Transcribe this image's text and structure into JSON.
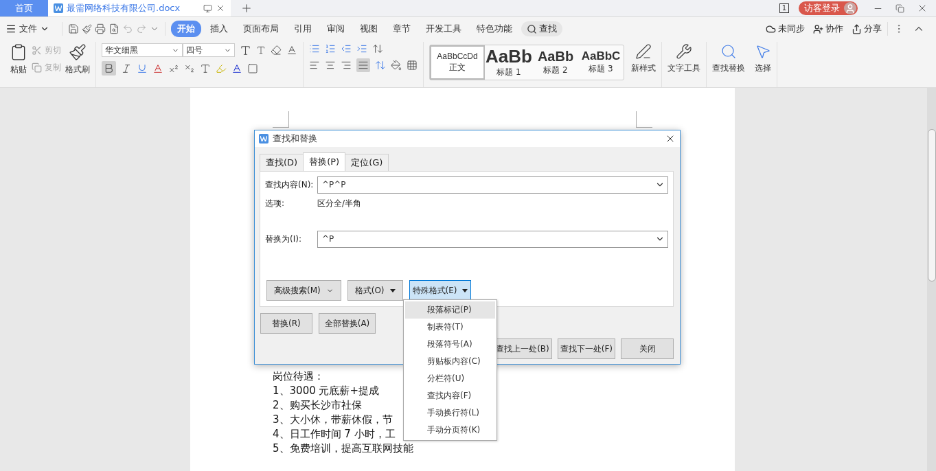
{
  "title_bar": {
    "home_tab": "首页",
    "documents": [
      {
        "title": "最需网络科技有限公司.docx",
        "selected": true
      }
    ],
    "page_indicator": "1",
    "login": "访客登录"
  },
  "menu_bar": {
    "file": "文件",
    "tabs": [
      {
        "label": "开始",
        "selected": true
      },
      {
        "label": "插入",
        "selected": false
      },
      {
        "label": "页面布局",
        "selected": false
      },
      {
        "label": "引用",
        "selected": false
      },
      {
        "label": "审阅",
        "selected": false
      },
      {
        "label": "视图",
        "selected": false
      },
      {
        "label": "章节",
        "selected": false
      },
      {
        "label": "开发工具",
        "selected": false
      },
      {
        "label": "特色功能",
        "selected": false
      }
    ],
    "search": "查找",
    "actions": [
      "未同步",
      "协作",
      "分享"
    ]
  },
  "ribbon": {
    "paste": "粘贴",
    "clipboard": [
      {
        "label": "剪切",
        "disabled": true
      },
      {
        "label": "复制",
        "disabled": true
      }
    ],
    "format_painter": "格式刷",
    "font": {
      "name": "华文细黑",
      "size": "四号"
    },
    "bold": {
      "pressed": true
    },
    "justify": {
      "pressed": true
    },
    "styles": [
      {
        "preview": "AaBbCcDd",
        "label": "正文",
        "kind": "body",
        "selected": true
      },
      {
        "preview": "AaBb",
        "label": "标题 1",
        "kind": "h1",
        "selected": false
      },
      {
        "preview": "AaBb",
        "label": "标题 2",
        "kind": "h2",
        "selected": false
      },
      {
        "preview": "AaBbC",
        "label": "标题 3",
        "kind": "h3",
        "selected": false
      }
    ],
    "tools": [
      "新样式",
      "文字工具",
      "查找替换",
      "选择"
    ]
  },
  "document": {
    "lines": [
      "岗位待遇：",
      "1、3000 元底薪+提成",
      "2、购买长沙市社保",
      "3、大小休，带薪休假，节",
      "4、日工作时间 7 小时，工",
      "5、免费培训，提高互联网技能"
    ]
  },
  "dialog": {
    "title": "查找和替换",
    "tabs": [
      {
        "label": "查找(D)",
        "selected": false
      },
      {
        "label": "替换(P)",
        "selected": true
      },
      {
        "label": "定位(G)",
        "selected": false
      }
    ],
    "find": {
      "label": "查找内容(N):",
      "value": "^P^P"
    },
    "options": {
      "label": "选项:",
      "value": "区分全/半角"
    },
    "replace": {
      "label": "替换为(I):",
      "value": "^P"
    },
    "option_buttons": [
      {
        "label": "高级搜索(M)",
        "active": false
      },
      {
        "label": "格式(O)",
        "active": false
      },
      {
        "label": "特殊格式(E)",
        "active": true
      }
    ],
    "replace_buttons": [
      "替换(R)",
      "全部替换(A)"
    ],
    "nav_buttons": [
      "查找上一处(B)",
      "查找下一处(F)",
      "关闭"
    ]
  },
  "special_menu": {
    "items": [
      {
        "label": "段落标记(P)",
        "selected": true
      },
      {
        "label": "制表符(T)",
        "selected": false
      },
      {
        "label": "段落符号(A)",
        "selected": false
      },
      {
        "label": "剪贴板内容(C)",
        "selected": false
      },
      {
        "label": "分栏符(U)",
        "selected": false
      },
      {
        "label": "查找内容(F)",
        "selected": false
      },
      {
        "label": "手动换行符(L)",
        "selected": false
      },
      {
        "label": "手动分页符(K)",
        "selected": false
      }
    ]
  }
}
